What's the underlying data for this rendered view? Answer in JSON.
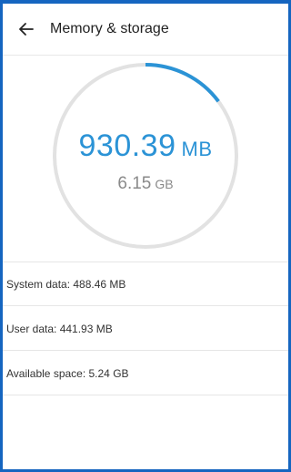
{
  "colors": {
    "accent": "#2b93d6",
    "frame": "#1565c0",
    "ring": "#e2e2e2",
    "secondary_text": "#8a8a8a"
  },
  "appbar": {
    "back_icon": "arrow-left-icon",
    "title": "Memory & storage"
  },
  "gauge": {
    "used_value": "930.39",
    "used_unit": "MB",
    "total_value": "6.15",
    "total_unit": "GB",
    "used_fraction": 0.148
  },
  "details": {
    "system_data": "System data: 488.46 MB",
    "user_data": "User data: 441.93 MB",
    "available_space": "Available space: 5.24 GB"
  }
}
